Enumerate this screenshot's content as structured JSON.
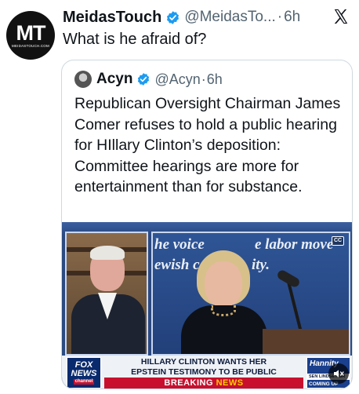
{
  "tweet": {
    "avatar_text": "MT",
    "avatar_subtext": "MEIDASTOUCH.COM",
    "display_name": "MeidasTouch",
    "handle": "@MeidasTo...",
    "separator": "·",
    "time": "6h",
    "text": "What is he afraid of?",
    "verified_color": "#1d9bf0"
  },
  "quote": {
    "display_name": "Acyn",
    "handle": "@Acyn",
    "separator": "·",
    "time": "6h",
    "text": "Republican Oversight Chairman James Comer refuses to hold a public hearing for HIllary Clinton’s deposition: Committee hearings are more for entertainment than for substance.",
    "media": {
      "stage_text_line1": "he voice",
      "stage_text_line1b": "e labor move",
      "stage_text_line2": "ewish c",
      "stage_text_line2b": "ity.",
      "cc_label": "CC",
      "network_line1": "FOX",
      "network_line2": "NEWS",
      "network_line3": "channel",
      "headline_line1": "HILLARY CLINTON WANTS HER",
      "headline_line2": "EPSTEIN TESTIMONY TO BE PUBLIC",
      "breaking_word": "BREAKING",
      "news_word": "NEWS",
      "show_name": "Hannity",
      "next_guest": "SEN LINDSEY GR",
      "coming_up": "COMING UP"
    }
  }
}
